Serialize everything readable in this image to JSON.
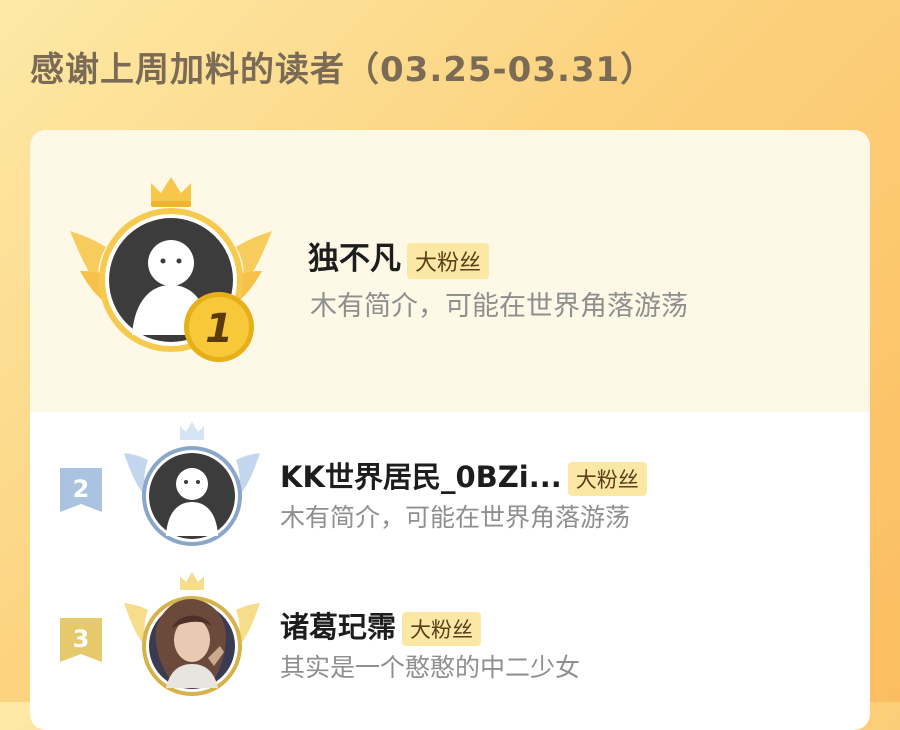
{
  "header": {
    "title": "感谢上周加料的读者（03.25-03.31）"
  },
  "badge_label": "大粉丝",
  "readers": [
    {
      "rank": "1",
      "name": "独不凡",
      "desc": "木有简介，可能在世界角落游荡"
    },
    {
      "rank": "2",
      "name": "KK世界居民_0BZi...",
      "desc": "木有简介，可能在世界角落游荡"
    },
    {
      "rank": "3",
      "name": "诸葛玘霈",
      "desc": "其实是一个憨憨的中二少女"
    }
  ],
  "colors": {
    "gold": "#f1c232",
    "silver": "#a9c3e0",
    "bronze": "#e5c96a",
    "badge_bg": "#fbe8a5"
  },
  "icons": [
    "crown-icon",
    "wings-icon",
    "default-avatar-icon",
    "rank-medal-icon",
    "rank-flag-icon"
  ]
}
